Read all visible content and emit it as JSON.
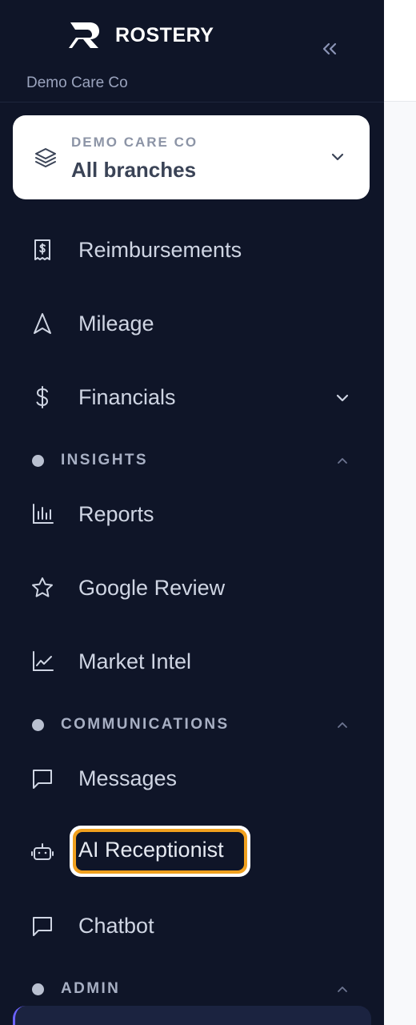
{
  "brand": {
    "name": "ROSTERY",
    "org_subtitle": "Demo Care Co"
  },
  "branch_selector": {
    "kicker": "DEMO CARE CO",
    "title": "All branches"
  },
  "nav_top": [
    {
      "label": "Reimbursements",
      "icon": "receipt-dollar-icon"
    },
    {
      "label": "Mileage",
      "icon": "navigation-arrow-icon"
    },
    {
      "label": "Financials",
      "icon": "dollar-icon",
      "has_submenu": true
    }
  ],
  "sections": {
    "insights": {
      "label": "INSIGHTS"
    },
    "communications": {
      "label": "COMMUNICATIONS"
    },
    "admin": {
      "label": "ADMIN"
    }
  },
  "nav_insights": [
    {
      "label": "Reports",
      "icon": "bar-chart-icon"
    },
    {
      "label": "Google Review",
      "icon": "star-icon"
    },
    {
      "label": "Market Intel",
      "icon": "line-chart-icon"
    }
  ],
  "nav_communications": [
    {
      "label": "Messages",
      "icon": "message-square-icon"
    },
    {
      "label": "AI Receptionist",
      "icon": "bot-icon",
      "highlighted": true
    },
    {
      "label": "Chatbot",
      "icon": "message-square-icon"
    }
  ],
  "colors": {
    "sidebar_bg": "#0f1528",
    "highlight": "#f0a01e",
    "text": "#cfd5e3"
  }
}
